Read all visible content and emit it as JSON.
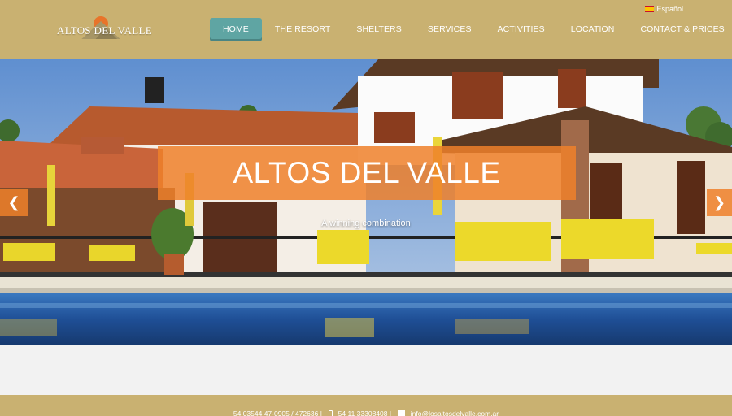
{
  "brand": {
    "logo_text": "ALTOS DEL VALLE"
  },
  "language": {
    "label": "Español",
    "flag_icon": "spain-flag-icon"
  },
  "nav": {
    "items": [
      {
        "label": "HOME",
        "active": true
      },
      {
        "label": "THE RESORT"
      },
      {
        "label": "SHELTERS"
      },
      {
        "label": "SERVICES"
      },
      {
        "label": "ACTIVITIES"
      },
      {
        "label": "LOCATION"
      },
      {
        "label": "CONTACT & PRICES"
      }
    ]
  },
  "hero": {
    "title": "ALTOS DEL VALLE",
    "subtitle": "A winning combination",
    "prev_icon": "chevron-left-icon",
    "next_icon": "chevron-right-icon"
  },
  "footer": {
    "phone_landline": "54 03544 47-0905 / 472636 |",
    "phone_mobile": "54 11 33308408 |",
    "email": "info@losaltosdelvalle.com.ar"
  },
  "colors": {
    "header_bg": "#c9b171",
    "nav_active": "#5fa5a3",
    "accent_orange": "#ee802a"
  }
}
